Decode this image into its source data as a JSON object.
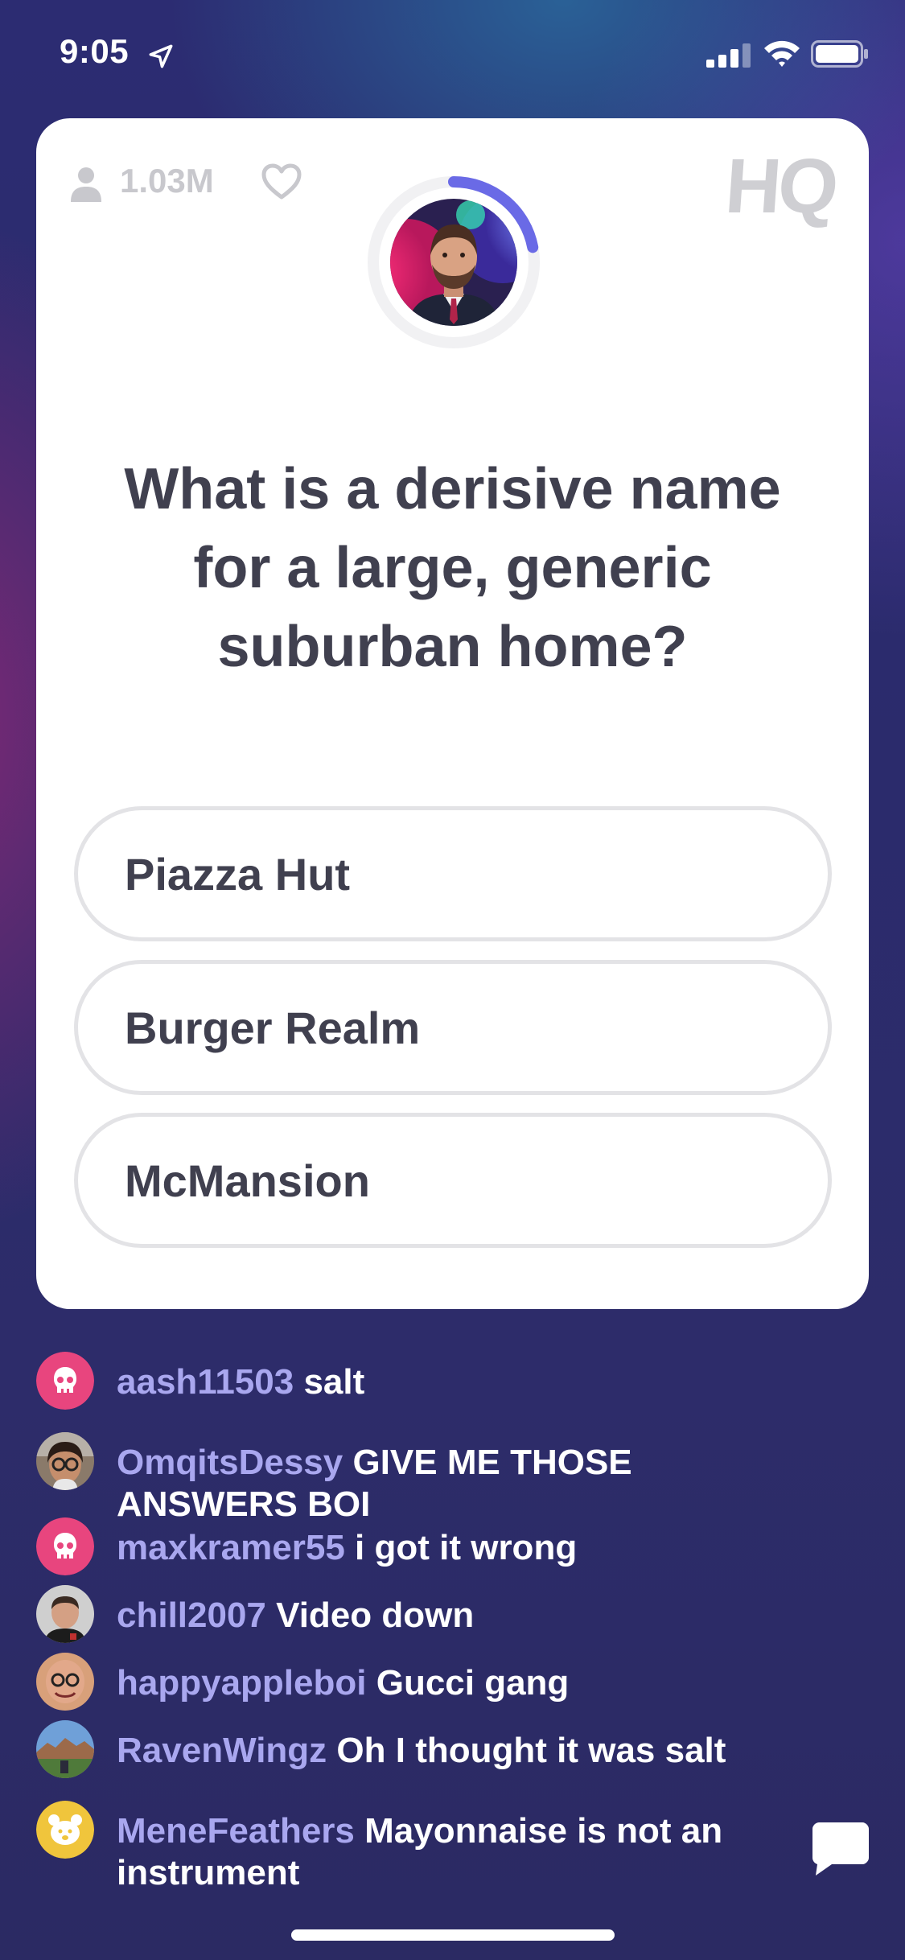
{
  "status_bar": {
    "time": "9:05"
  },
  "card": {
    "viewer_count": "1.03M",
    "logo": "HQ",
    "question": "What is a derisive name for a large, generic suburban home?",
    "answers": [
      {
        "label": "Piazza Hut"
      },
      {
        "label": "Burger Realm"
      },
      {
        "label": "McMansion"
      }
    ],
    "timer_progress": 0.22,
    "accent_color": "#6a6ae6"
  },
  "chat": {
    "messages": [
      {
        "user": "aash11503",
        "text": "salt",
        "avatar": "skull-pink"
      },
      {
        "user": "OmqitsDessy",
        "text": "GIVE ME THOSE ANSWERS BOI",
        "avatar": "photo-glasses"
      },
      {
        "user": "maxkramer55",
        "text": "i got it wrong",
        "avatar": "skull-pink"
      },
      {
        "user": "chill2007",
        "text": "Video down",
        "avatar": "photo-man"
      },
      {
        "user": "happyappleboi",
        "text": "Gucci gang",
        "avatar": "photo-bald"
      },
      {
        "user": "RavenWingz",
        "text": "Oh I thought it was salt",
        "avatar": "photo-landscape"
      },
      {
        "user": "MeneFeathers",
        "text": "Mayonnaise is not an instrument",
        "avatar": "bear-yellow"
      }
    ]
  }
}
